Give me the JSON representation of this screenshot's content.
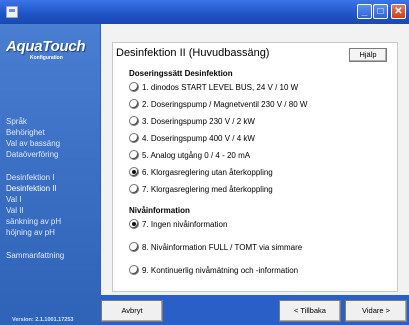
{
  "window": {
    "minimize": "_",
    "maximize": "□",
    "close": "✕"
  },
  "sidebar": {
    "logo": "AquaTouch",
    "logo_sub": "Konfiguration",
    "items": [
      "Språk",
      "Behörighet",
      "Val av bassäng",
      "Dataöverföring",
      "Desinfektion I",
      "Desinfektion II",
      "Val I",
      "Val II",
      "sänkning av pH",
      "höjning av pH",
      "Sammanfattning"
    ],
    "active_item": "Desinfektion II",
    "version": "Version: 2.1.1001.17253"
  },
  "main": {
    "title": "Desinfektion II (Huvudbassäng)",
    "help_label": "Hjälp",
    "dosing_section": "Doseringssätt Desinfektion",
    "dosing_options": [
      {
        "label": "1. dinodos START LEVEL BUS, 24 V / 10 W",
        "checked": false
      },
      {
        "label": "2. Doseringspump / Magnetventil 230 V / 80 W",
        "checked": false
      },
      {
        "label": "3. Doseringspump 230 V / 2 kW",
        "checked": false
      },
      {
        "label": "4. Doseringspump 400 V / 4 kW",
        "checked": false
      },
      {
        "label": "5. Analog utgång 0 / 4 - 20 mA",
        "checked": false
      },
      {
        "label": "6. Klorgasreglering utan återkoppling",
        "checked": true
      },
      {
        "label": "7. Klorgasreglering med återkoppling",
        "checked": false
      }
    ],
    "level_section": "Nivåinformation",
    "level_options": [
      {
        "label": "7. Ingen nivåinformation",
        "checked": true
      },
      {
        "label": "8. Nivåinformation FULL / TOMT via simmare",
        "checked": false
      },
      {
        "label": "9. Kontinuerlig nivåmätning och -information",
        "checked": false
      }
    ]
  },
  "footer": {
    "cancel_label": "Avbryt",
    "back_label": "< Tillbaka",
    "next_label": "Vidare >"
  }
}
